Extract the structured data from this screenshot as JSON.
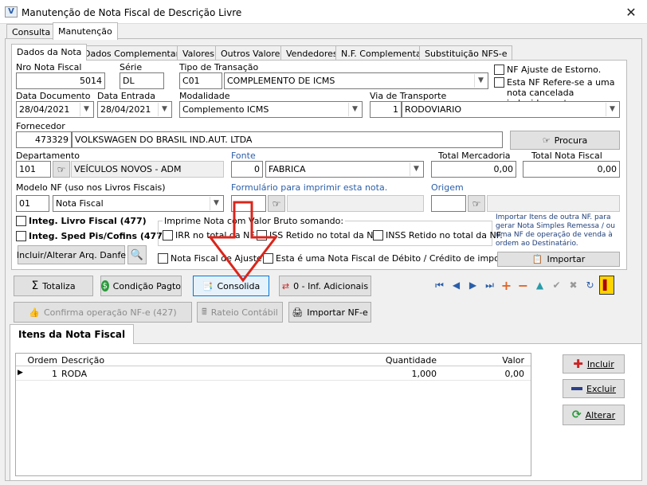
{
  "window": {
    "title": "Manutenção de Nota Fiscal de Descrição Livre",
    "close": "✕"
  },
  "main_tabs": [
    "Consulta",
    "Manutenção"
  ],
  "sub_tabs": [
    "Dados da Nota",
    "Dados Complementares",
    "Valores",
    "Outros Valores",
    "Vendedores",
    "N.F. Complementar",
    "Substituição NFS-e"
  ],
  "form": {
    "nro_label": "Nro Nota Fiscal",
    "nro": "5014",
    "serie_label": "Série",
    "serie": "DL",
    "tipo_label": "Tipo de Transação",
    "tipo_code": "C01",
    "tipo_desc": "COMPLEMENTO DE ICMS",
    "ajuste_estorno": "NF Ajuste de Estorno.",
    "refere": "Esta NF Refere-se a uma nota cancelada indevidamente",
    "data_doc_label": "Data Documento",
    "data_doc": "28/04/2021",
    "data_ent_label": "Data Entrada",
    "data_ent": "28/04/2021",
    "modalidade_label": "Modalidade",
    "modalidade": "Complemento ICMS",
    "via_label": "Via de Transporte",
    "via_code": "1",
    "via_desc": "RODOVIARIO",
    "fornecedor_label": "Fornecedor",
    "fornecedor_code": "473329",
    "fornecedor_nome": "VOLKSWAGEN DO BRASIL IND.AUT. LTDA",
    "procura": "Procura",
    "departamento_label": "Departamento",
    "departamento_code": "101",
    "departamento_desc": "VEÍCULOS NOVOS - ADM",
    "fonte_label": "Fonte",
    "fonte_code": "0",
    "fonte_desc": "FABRICA",
    "total_merc_label": "Total Mercadoria",
    "total_merc": "0,00",
    "total_nf_label": "Total Nota Fiscal",
    "total_nf": "0,00",
    "modelo_label": "Modelo NF (uso nos Livros Fiscais)",
    "modelo_code": "01",
    "modelo_desc": "Nota Fiscal",
    "formulario_label": "Formulário para imprimir esta nota.",
    "origem_label": "Origem",
    "integ_livro": "Integ. Livro Fiscal (477)",
    "integ_sped": "Integ. Sped Pis/Cofins (477)",
    "incluir_danfe": "Incluir/Alterar Arq. Danfe",
    "imprime_label": "Imprime Nota com Valor Bruto somando:",
    "irr": "IRR no total da NF.",
    "iss": "ISS Retido no total da NF.",
    "inss": "INSS Retido no total da NF.",
    "nf_ajuste": "Nota Fiscal de Ajuste",
    "nf_debito": "Esta é uma Nota Fiscal de Débito / Crédito de impostos",
    "importar_info": "Importar Itens de outra NF. para gerar Nota Simples Remessa / ou uma NF de operação de venda à ordem ao Destinatário.",
    "importar": "Importar"
  },
  "actions": {
    "totaliza": "Totaliza",
    "condicao": "Condição Pagto",
    "consolida": "Consolida",
    "inf_adicionais": "0 - Inf. Adicionais",
    "confirma": "Confirma operação NF-e (427)",
    "rateio": "Rateio Contábil",
    "importar_nfe": "Importar NF-e"
  },
  "itens": {
    "tab": "Itens da Nota Fiscal",
    "headers": [
      "Ordem",
      "Descrição",
      "Quantidade",
      "Valor"
    ],
    "rows": [
      {
        "ordem": "1",
        "descricao": "RODA",
        "quantidade": "1,000",
        "valor": "0,00"
      }
    ],
    "incluir": "Incluir",
    "excluir": "Excluir",
    "alterar": "Alterar"
  },
  "colors": {
    "accent": "#2b5ea8",
    "highlight": "#cce4f7",
    "arrow": "#d9261c"
  }
}
